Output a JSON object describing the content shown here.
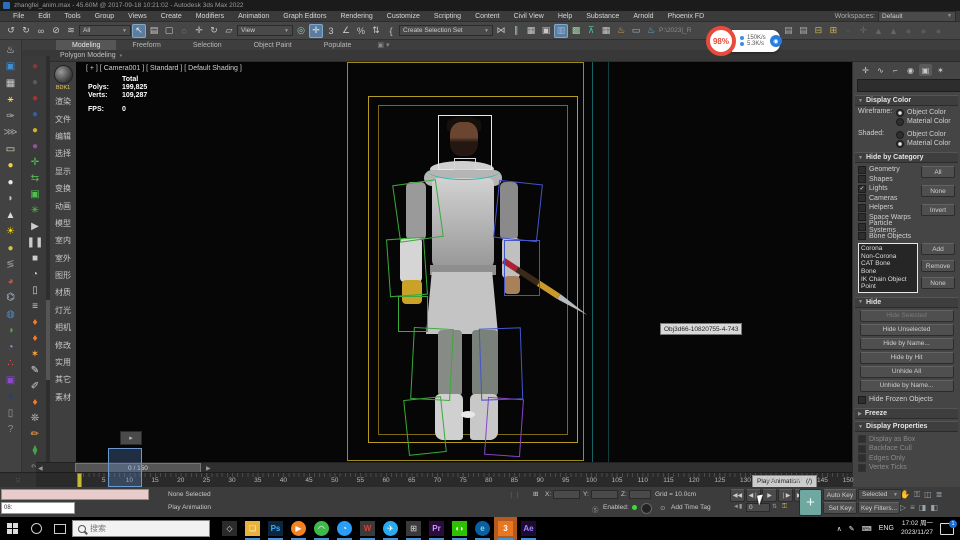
{
  "window": {
    "title": "zhangfei_anim.max - 45.60M @ 2017-09-18 10:21:02 - Autodesk 3ds Max 2022"
  },
  "menu": {
    "items": [
      "File",
      "Edit",
      "Tools",
      "Group",
      "Views",
      "Create",
      "Modifiers",
      "Animation",
      "Graph Editors",
      "Rendering",
      "Customize",
      "Scripting",
      "Content",
      "Civil View",
      "Help",
      "Substance",
      "Arnold",
      "Phoenix FD"
    ],
    "workspaces_label": "Workspaces:",
    "workspace_value": "Default"
  },
  "toolbar": {
    "icons": [
      {
        "g": "↺",
        "c": "#c8c8c8",
        "state": ""
      },
      {
        "g": "↻",
        "c": "#c8c8c8",
        "state": ""
      },
      {
        "g": "∞",
        "c": "#c8c8c8",
        "state": ""
      },
      {
        "g": "⊘",
        "c": "#c8c8c8",
        "state": ""
      },
      {
        "g": "≋",
        "c": "#c8c8c8",
        "state": ""
      }
    ],
    "filter_value": "All",
    "icons2": [
      {
        "g": "↖",
        "c": "#e8e8e8",
        "state": "hl"
      },
      {
        "g": "▤",
        "c": "#c8c8c8",
        "state": ""
      },
      {
        "g": "▢",
        "c": "#c8c8c8",
        "state": ""
      },
      {
        "g": "◌",
        "c": "#c8c8c8",
        "state": ""
      },
      {
        "g": "✛",
        "c": "#c8c8c8",
        "state": ""
      },
      {
        "g": "↻",
        "c": "#c8c8c8",
        "state": ""
      },
      {
        "g": "▱",
        "c": "#c8c8c8",
        "state": ""
      }
    ],
    "ref_value": "View",
    "icons3": [
      {
        "g": "◎",
        "c": "#8fd0c0",
        "state": ""
      },
      {
        "g": "✛",
        "c": "#e8e8e8",
        "state": "hl"
      },
      {
        "g": "3",
        "c": "#c8c8c8",
        "state": ""
      },
      {
        "g": "∠",
        "c": "#c8c8c8",
        "state": ""
      },
      {
        "g": "%",
        "c": "#c8c8c8",
        "state": ""
      },
      {
        "g": "⇅",
        "c": "#c8c8c8",
        "state": ""
      },
      {
        "g": "{",
        "c": "#c8c8c8",
        "state": ""
      }
    ],
    "selset_value": "Create Selection Set",
    "icons4": [
      {
        "g": "⋈",
        "c": "#c8c8c8",
        "state": ""
      },
      {
        "g": "∥",
        "c": "#9fd09f",
        "state": ""
      },
      {
        "g": "▦",
        "c": "#c8c8c8",
        "state": ""
      },
      {
        "g": "▣",
        "c": "#c8c8c8",
        "state": ""
      },
      {
        "g": "▥",
        "c": "#9ab8d8",
        "state": "hl"
      },
      {
        "g": "▩",
        "c": "#9fd09f",
        "state": ""
      },
      {
        "g": "⊼",
        "c": "#4fc0a0",
        "state": ""
      },
      {
        "g": "▦",
        "c": "#c8c8c8",
        "state": ""
      },
      {
        "g": "♨",
        "c": "#d8b050",
        "state": ""
      },
      {
        "g": "▭",
        "c": "#9ab8d8",
        "state": ""
      },
      {
        "g": "♨",
        "c": "#60b8d8",
        "state": ""
      }
    ],
    "path_text": "P:\\2023|_R",
    "icons5": [
      {
        "g": "▤",
        "c": "#a8a8a8",
        "state": ""
      },
      {
        "g": "▤",
        "c": "#a8a8a8",
        "state": ""
      },
      {
        "g": "⊟",
        "c": "#c8b050",
        "state": ""
      },
      {
        "g": "⊞",
        "c": "#c8b050",
        "state": ""
      },
      {
        "g": "◦",
        "c": "#666666",
        "state": ""
      },
      {
        "g": "✛",
        "c": "#666666",
        "state": ""
      },
      {
        "g": "▲",
        "c": "#666666",
        "state": ""
      },
      {
        "g": "▲",
        "c": "#666666",
        "state": ""
      },
      {
        "g": "●",
        "c": "#5a5a5a",
        "state": ""
      },
      {
        "g": "●",
        "c": "#5a5a5a",
        "state": ""
      },
      {
        "g": "●",
        "c": "#5a5a5a",
        "state": ""
      }
    ]
  },
  "net_widget": {
    "percent": "98%",
    "down": "150K/s",
    "up": "5.3K/s",
    "ball": "◉"
  },
  "ribbon": {
    "tabs": [
      {
        "label": "Modeling",
        "state": "active"
      },
      {
        "label": "Freeform",
        "state": ""
      },
      {
        "label": "Selection",
        "state": ""
      },
      {
        "label": "Object Paint",
        "state": ""
      },
      {
        "label": "Populate",
        "state": ""
      }
    ],
    "panel_label": "Polygon Modeling",
    "caret": "▾"
  },
  "strip1": {
    "icons": [
      {
        "g": "♨",
        "c": "#d8d8d8"
      },
      {
        "g": "▣",
        "c": "#3f8fd4"
      },
      {
        "g": "▦",
        "c": "#cccccc"
      },
      {
        "g": "⚹",
        "c": "#ffd54a"
      },
      {
        "g": "✑",
        "c": "#bbbbbb"
      },
      {
        "g": "⋙",
        "c": "#a0a0a0"
      },
      {
        "g": "▭",
        "c": "#e6e2c4"
      },
      {
        "g": "●",
        "c": "#f0d040"
      },
      {
        "g": "●",
        "c": "#e8e8e8"
      },
      {
        "g": "◗",
        "c": "#c4c4c4"
      },
      {
        "g": "▲",
        "c": "#dddddd"
      },
      {
        "g": "☀",
        "c": "#ffd700"
      },
      {
        "g": "●",
        "c": "#cfc04a"
      },
      {
        "g": "≶",
        "c": "#999999"
      },
      {
        "g": "◕",
        "c": "#cc5544"
      },
      {
        "g": "⌬",
        "c": "#b0c4de"
      },
      {
        "g": "◍",
        "c": "#4a8ecc"
      },
      {
        "g": "◑",
        "c": "#58aa48"
      },
      {
        "g": "◔",
        "c": "#88aadd"
      },
      {
        "g": "∴",
        "c": "#dd5544"
      },
      {
        "g": "▣",
        "c": "#8a4acc"
      },
      {
        "g": "●",
        "c": "#28406e"
      },
      {
        "g": "▯",
        "c": "#9a9a9a"
      },
      {
        "g": "?",
        "c": "#8a8a8a"
      }
    ]
  },
  "strip2": {
    "icons": [
      {
        "g": "●",
        "c": "#8a3838"
      },
      {
        "g": "●",
        "c": "#5a5a5a"
      },
      {
        "g": "●",
        "c": "#b03030"
      },
      {
        "g": "●",
        "c": "#3060aa"
      },
      {
        "g": "●",
        "c": "#cfae2a"
      },
      {
        "g": "●",
        "c": "#9050a0"
      },
      {
        "g": "✛",
        "c": "#4ec04e"
      },
      {
        "g": "⇆",
        "c": "#4ec04e"
      },
      {
        "g": "▣",
        "c": "#4ec04e"
      },
      {
        "g": "✳",
        "c": "#4ec04e"
      },
      {
        "g": "▶",
        "c": "#cccccc"
      },
      {
        "g": "❚❚",
        "c": "#cccccc"
      },
      {
        "g": "■",
        "c": "#cccccc"
      },
      {
        "g": "◔",
        "c": "#cccccc"
      },
      {
        "g": "▯",
        "c": "#cccccc"
      },
      {
        "g": "≡",
        "c": "#cccccc"
      },
      {
        "g": "♦",
        "c": "#ff7a22"
      },
      {
        "g": "♦",
        "c": "#ff7a22"
      },
      {
        "g": "✶",
        "c": "#ffaa33"
      },
      {
        "g": "✎",
        "c": "#dddddd"
      },
      {
        "g": "✐",
        "c": "#cccccc"
      },
      {
        "g": "♦",
        "c": "#ff7a22"
      },
      {
        "g": "❊",
        "c": "#cccccc"
      },
      {
        "g": "✏",
        "c": "#ffaa44"
      },
      {
        "g": "⧫",
        "c": "#48a048"
      },
      {
        "g": "∾",
        "c": "#888888"
      }
    ]
  },
  "palette": {
    "logo_label": "BDK1",
    "items": [
      "渲染",
      "文件",
      "编辑",
      "选择",
      "显示",
      "变换",
      "动画",
      "模型",
      "室内",
      "室外",
      "图形",
      "材质",
      "灯光",
      "相机",
      "修改",
      "实用",
      "其它",
      "素材"
    ]
  },
  "viewport": {
    "label": "[ + ] [ Camera001 ] [ Standard ] [ Default Shading ]",
    "stats": {
      "total_label": "Total",
      "polys_label": "Polys:",
      "polys_value": "199,825",
      "verts_label": "Verts:",
      "verts_value": "109,287",
      "fps_label": "FPS:",
      "fps_value": "0"
    },
    "tooltip": "Obj3d66-10820755-4-743"
  },
  "command_panel": {
    "tabs": [
      {
        "g": "✛",
        "state": ""
      },
      {
        "g": "∿",
        "state": ""
      },
      {
        "g": "⌐",
        "state": ""
      },
      {
        "g": "◉",
        "state": ""
      },
      {
        "g": "▣",
        "state": "active"
      },
      {
        "g": "✶",
        "state": ""
      }
    ],
    "display_color": {
      "title": "Display Color",
      "wireframe_label": "Wireframe:",
      "shaded_label": "Shaded:",
      "object_color": "Object Color",
      "material_color": "Material Color"
    },
    "hide_by_category": {
      "title": "Hide by Category",
      "categories": [
        {
          "label": "Geometry",
          "check": ""
        },
        {
          "label": "Shapes",
          "check": ""
        },
        {
          "label": "Lights",
          "check": "✓"
        },
        {
          "label": "Cameras",
          "check": ""
        },
        {
          "label": "Helpers",
          "check": ""
        },
        {
          "label": "Space Warps",
          "check": ""
        },
        {
          "label": "Particle Systems",
          "check": ""
        },
        {
          "label": "Bone Objects",
          "check": ""
        }
      ],
      "side_buttons": [
        "All",
        "None",
        "Invert"
      ],
      "list_items": [
        "Corona",
        "Non-Corona",
        "CAT Bone",
        "Bone",
        "IK Chain Object",
        "Point"
      ],
      "list_buttons": [
        "Add",
        "Remove",
        "None"
      ]
    },
    "hide": {
      "title": "Hide",
      "buttons": [
        {
          "label": "Hide Selected",
          "state": "disabled"
        },
        {
          "label": "Hide Unselected",
          "state": ""
        },
        {
          "label": "Hide by Name...",
          "state": ""
        },
        {
          "label": "Hide by Hit",
          "state": ""
        },
        {
          "label": "Unhide All",
          "state": ""
        },
        {
          "label": "Unhide by Name...",
          "state": ""
        }
      ],
      "checkbox_label": "Hide Frozen Objects"
    },
    "freeze_title": "Freeze",
    "display_properties": {
      "title": "Display Properties",
      "items": [
        "Display as Box",
        "Backface Cull",
        "Edges Only",
        "Vertex Ticks"
      ]
    }
  },
  "timeline": {
    "slider_value": "0 / 150",
    "left_arrow": "◀",
    "right_arrow": "▶",
    "ticks": [
      "5",
      "10",
      "15",
      "20",
      "25",
      "30",
      "35",
      "40",
      "45",
      "50",
      "55",
      "60",
      "65",
      "70",
      "75",
      "80",
      "85",
      "90",
      "95",
      "100",
      "105",
      "110",
      "115",
      "120",
      "125",
      "130",
      "135",
      "140",
      "145",
      "150"
    ],
    "play_tooltip": "Play Animation",
    "play_tooltip_key": "(/)",
    "keyfilter_glyph": "⁙"
  },
  "status_bar": {
    "none_selected": "None Selected",
    "listener_input": "08:",
    "play_animation": "Play Animation",
    "grid_icon": "⋮⋮",
    "x_label": "X:",
    "y_label": "Y:",
    "z_label": "Z:",
    "grid_label": "Grid = 10.0cm",
    "enabled_icon": "Ⓢ",
    "enabled_label": "Enabled:",
    "time_tag_icon": "⊙",
    "add_time_tag": "Add Time Tag",
    "transport": [
      "◀◀",
      "◀❘",
      "▶",
      "❘▶",
      "▶▶"
    ],
    "frame_value": "0",
    "spinner": "⇅",
    "key_icon": "⚿",
    "plus": "+",
    "auto_key": "Auto Key",
    "set_key": "Set Key",
    "selected_value": "Selected",
    "key_filters": "Key Filters...",
    "right_icons_row1": [
      "✋",
      "⚿",
      "◫",
      "≣"
    ],
    "right_icons_row2": [
      "▷",
      "≡",
      "◨",
      "◧"
    ]
  },
  "taskbar": {
    "search_placeholder": "搜索",
    "apps": [
      {
        "name": "app-launcher",
        "glyph": "◇",
        "bg": "#2b2b2b",
        "fg": "#dddddd",
        "shape": "",
        "state": "",
        "open": ""
      },
      {
        "name": "file-explorer",
        "glyph": "❏",
        "bg": "#e8b33d",
        "fg": "#fff3cf",
        "shape": "",
        "state": "",
        "open": "y"
      },
      {
        "name": "photoshop",
        "glyph": "Ps",
        "bg": "#0b2740",
        "fg": "#3fa9f5",
        "shape": "",
        "state": "",
        "open": "y"
      },
      {
        "name": "media-player",
        "glyph": "▶",
        "bg": "#f58220",
        "fg": "#ffffff",
        "shape": "round",
        "state": "",
        "open": "y"
      },
      {
        "name": "browser-360",
        "glyph": "◠",
        "bg": "#3dbb4a",
        "fg": "#ffffff",
        "shape": "round",
        "state": "",
        "open": "y"
      },
      {
        "name": "quark",
        "glyph": "◔",
        "bg": "#2a9df4",
        "fg": "#ffffff",
        "shape": "round",
        "state": "",
        "open": "y"
      },
      {
        "name": "wps",
        "glyph": "W",
        "bg": "#3a3a3a",
        "fg": "#e03e2d",
        "shape": "",
        "state": "",
        "open": "y"
      },
      {
        "name": "telegram",
        "glyph": "✈",
        "bg": "#2aabee",
        "fg": "#ffffff",
        "shape": "round",
        "state": "",
        "open": "y"
      },
      {
        "name": "app-grid",
        "glyph": "⊞",
        "bg": "#3a3a3a",
        "fg": "#cccccc",
        "shape": "",
        "state": "",
        "open": "y"
      },
      {
        "name": "premiere",
        "glyph": "Pr",
        "bg": "#2a0d3a",
        "fg": "#c79bff",
        "shape": "",
        "state": "",
        "open": "y"
      },
      {
        "name": "wechat",
        "glyph": "◖◗",
        "bg": "#2dc100",
        "fg": "#ffffff",
        "shape": "",
        "state": "",
        "open": "y"
      },
      {
        "name": "edge",
        "glyph": "e",
        "bg": "#0c5f9e",
        "fg": "#7ad0f0",
        "shape": "round",
        "state": "",
        "open": "y"
      },
      {
        "name": "max-3ds",
        "glyph": "3",
        "bg": "#e87722",
        "fg": "#ffffff",
        "shape": "",
        "state": "active",
        "open": "y"
      },
      {
        "name": "after-effects",
        "glyph": "Ae",
        "bg": "#1f0a33",
        "fg": "#9a8aff",
        "shape": "",
        "state": "",
        "open": "y"
      }
    ],
    "tray": {
      "caret": "∧",
      "pen": "✎",
      "keyboard": "⌨",
      "lang": "ENG",
      "time": "17:02 周一",
      "date": "2023/11/27",
      "badge": "1"
    }
  }
}
